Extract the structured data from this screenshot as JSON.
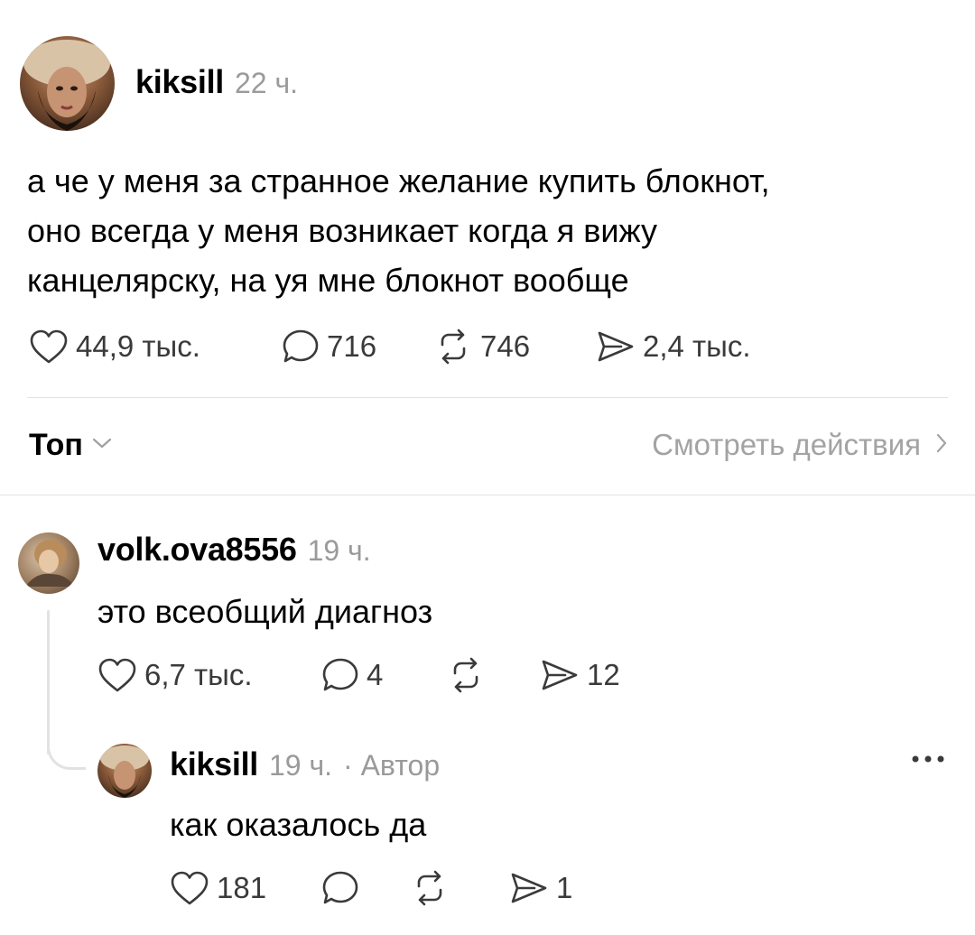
{
  "post": {
    "author": "kiksill",
    "time": "22 ч.",
    "text_lines": [
      "а че у меня за странное желание купить блокнот,",
      "оно всегда у меня возникает когда я вижу",
      "канцелярску, на  уя мне блокнот вообще"
    ],
    "likes": "44,9 тыс.",
    "comments": "716",
    "reposts": "746",
    "shares": "2,4 тыс."
  },
  "sort": {
    "label": "Топ",
    "view_activity": "Смотреть действия"
  },
  "replies": [
    {
      "author": "volk.ova8556",
      "time": "19 ч.",
      "text": "это всеобщий диагноз",
      "likes": "6,7 тыс.",
      "comments": "4",
      "reposts": "",
      "shares": "12"
    },
    {
      "author": "kiksill",
      "time": "19 ч.",
      "author_tag": "· Автор",
      "text": "как оказалось да",
      "likes": "181",
      "comments": "",
      "reposts": "",
      "shares": "1"
    }
  ],
  "icons": {
    "like": "heart-icon",
    "comment": "comment-bubble-icon",
    "repost": "repost-icon",
    "share": "send-icon",
    "more": "more-dots-icon",
    "chevron_down": "chevron-down-icon",
    "chevron_right": "chevron-right-icon"
  }
}
